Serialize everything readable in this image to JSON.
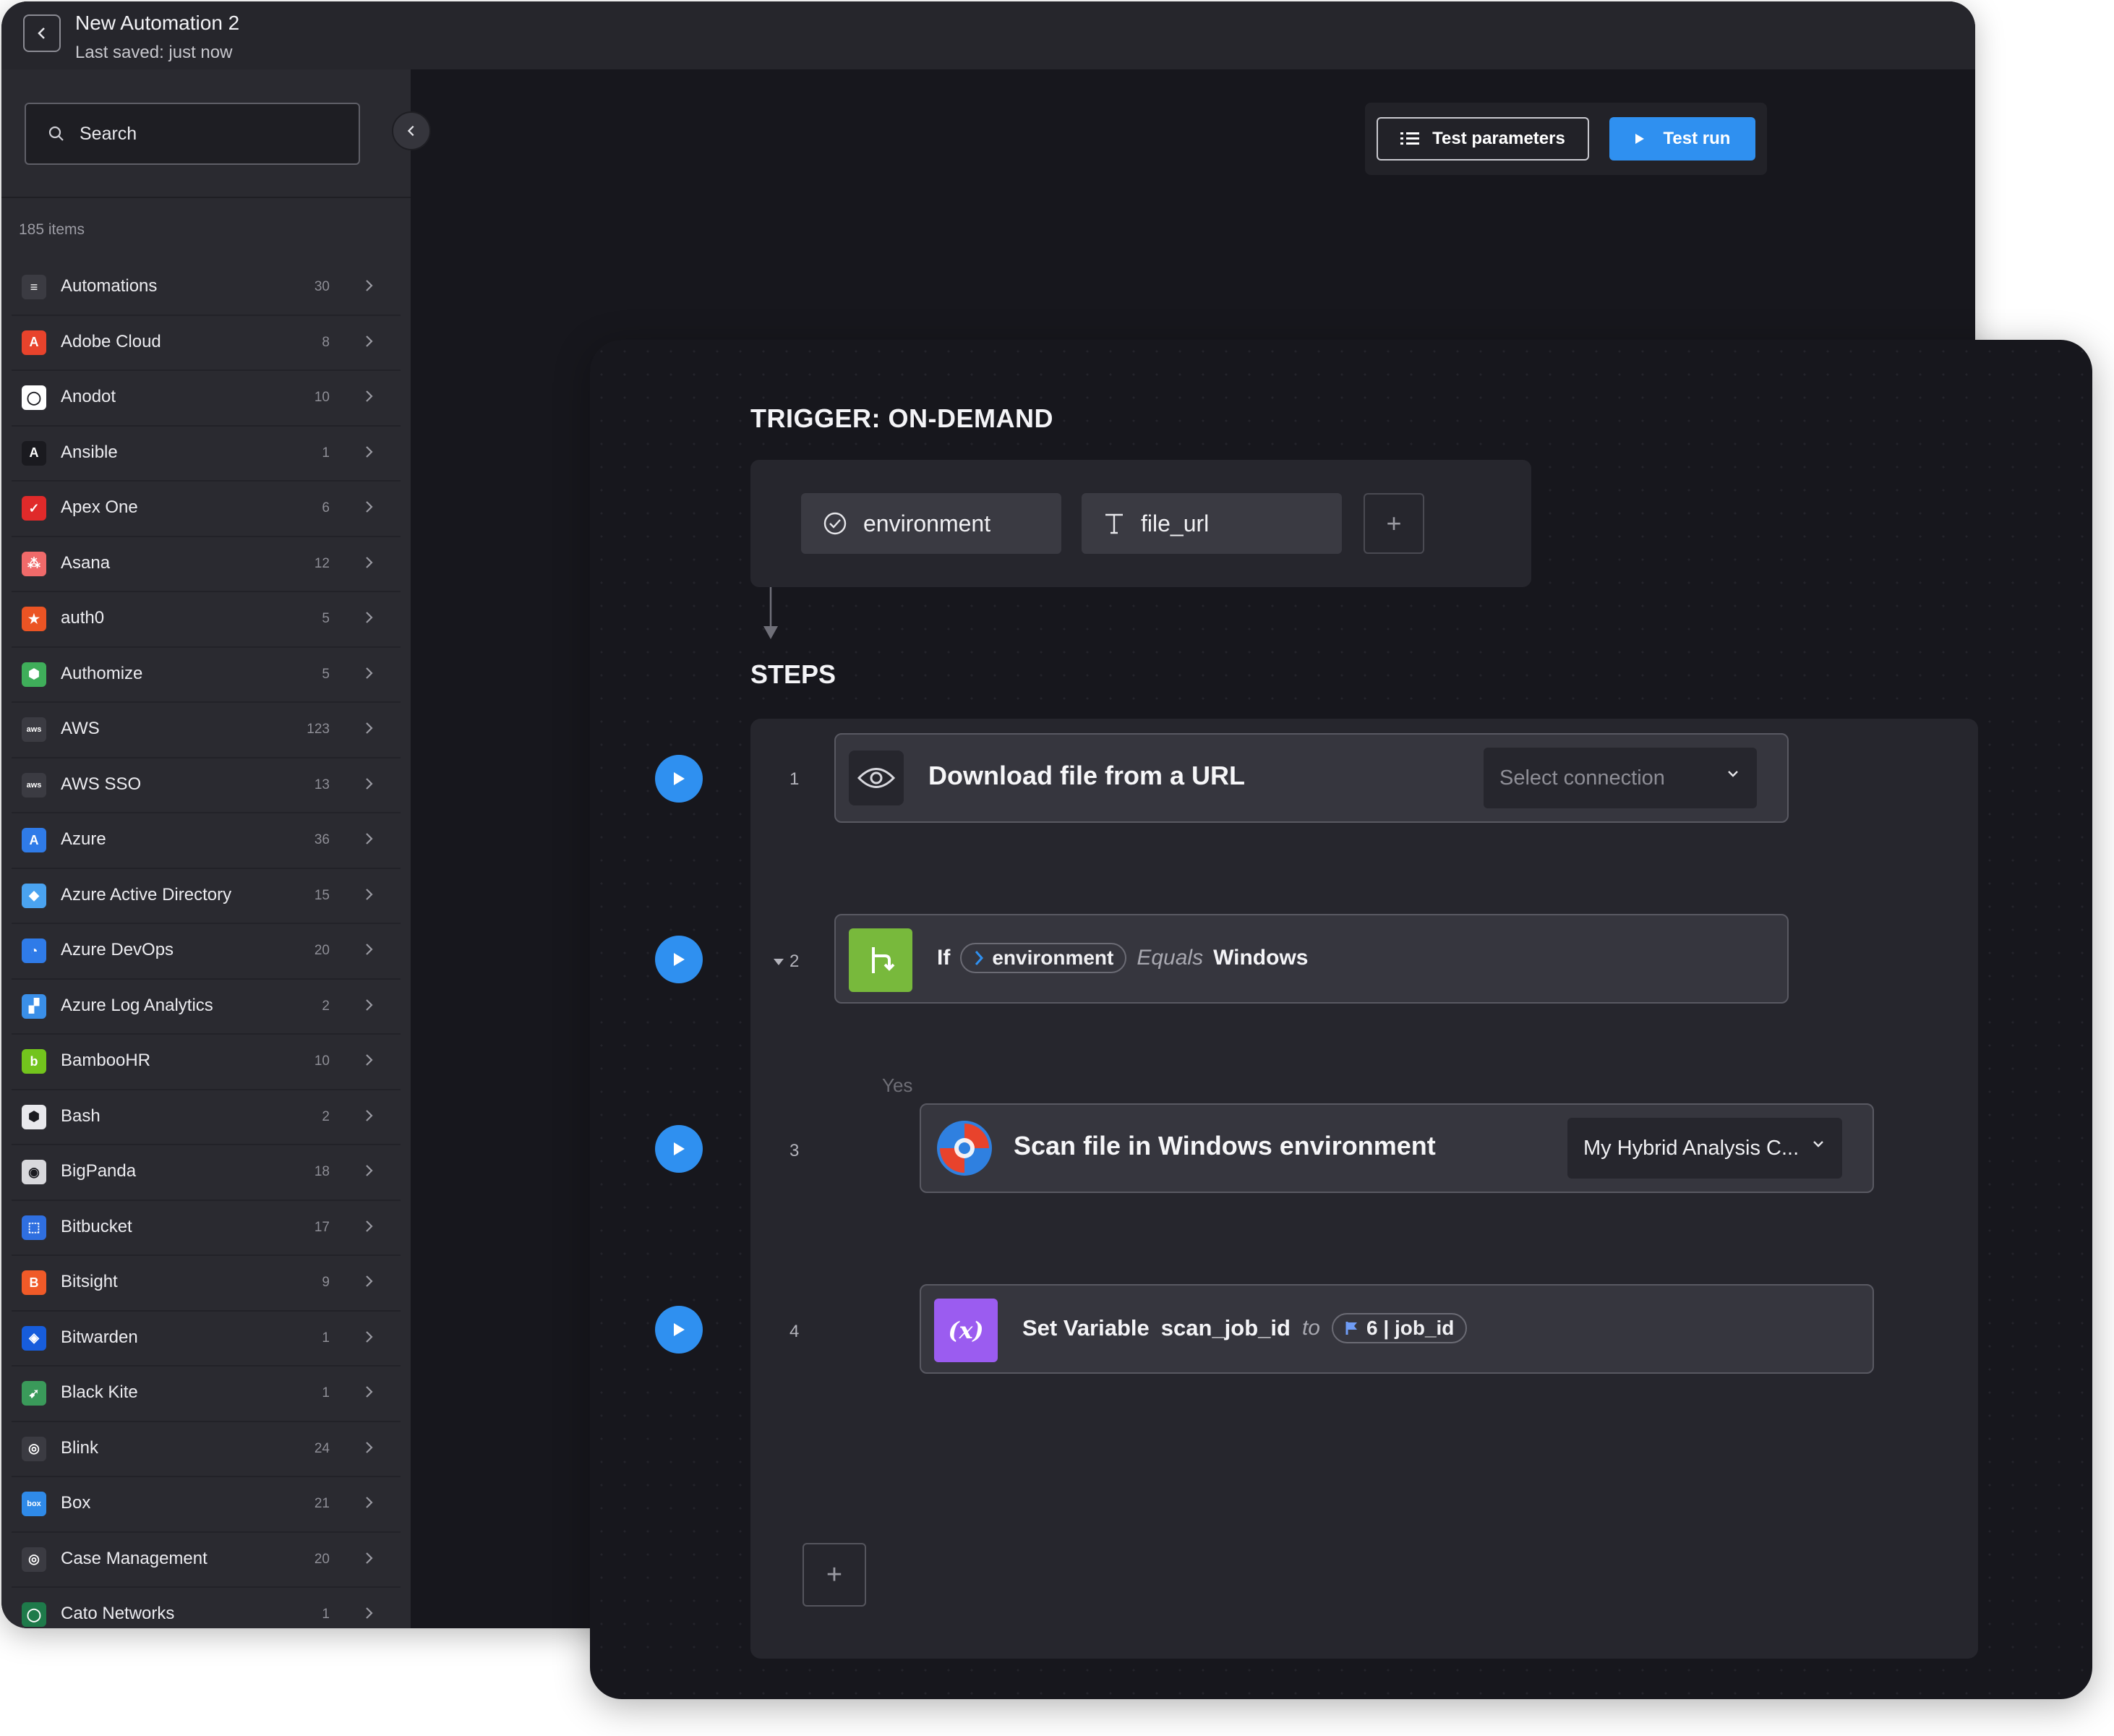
{
  "window": {
    "title": "New Automation 2",
    "subtitle": "Last saved: just now"
  },
  "sidebar": {
    "search_placeholder": "Search",
    "count_label": "185 items",
    "items": [
      {
        "label": "Automations",
        "count": "30",
        "icon": "automations-icon",
        "color": "#3b3b42"
      },
      {
        "label": "Adobe Cloud",
        "count": "8",
        "icon": "adobe-icon",
        "color": "#e8432c"
      },
      {
        "label": "Anodot",
        "count": "10",
        "icon": "anodot-icon",
        "color": "#ffffff"
      },
      {
        "label": "Ansible",
        "count": "1",
        "icon": "ansible-icon",
        "color": "#1a1a1f"
      },
      {
        "label": "Apex One",
        "count": "6",
        "icon": "apex-one-icon",
        "color": "#e02a2a"
      },
      {
        "label": "Asana",
        "count": "12",
        "icon": "asana-icon",
        "color": "#f06a6a"
      },
      {
        "label": "auth0",
        "count": "5",
        "icon": "auth0-icon",
        "color": "#eb5424"
      },
      {
        "label": "Authomize",
        "count": "5",
        "icon": "authomize-icon",
        "color": "#3fae5a"
      },
      {
        "label": "AWS",
        "count": "123",
        "icon": "aws-icon",
        "color": "#3b3b42"
      },
      {
        "label": "AWS SSO",
        "count": "13",
        "icon": "aws-sso-icon",
        "color": "#3b3b42"
      },
      {
        "label": "Azure",
        "count": "36",
        "icon": "azure-icon",
        "color": "#2f7be8"
      },
      {
        "label": "Azure Active Directory",
        "count": "15",
        "icon": "azure-ad-icon",
        "color": "#4aa3f0"
      },
      {
        "label": "Azure DevOps",
        "count": "20",
        "icon": "azure-devops-icon",
        "color": "#2f7be8"
      },
      {
        "label": "Azure Log Analytics",
        "count": "2",
        "icon": "azure-log-analytics-icon",
        "color": "#3a8fe8"
      },
      {
        "label": "BambooHR",
        "count": "10",
        "icon": "bamboohr-icon",
        "color": "#73c41d"
      },
      {
        "label": "Bash",
        "count": "2",
        "icon": "bash-icon",
        "color": "#e8e8ec"
      },
      {
        "label": "BigPanda",
        "count": "18",
        "icon": "bigpanda-icon",
        "color": "#d8d8dc"
      },
      {
        "label": "Bitbucket",
        "count": "17",
        "icon": "bitbucket-icon",
        "color": "#2f6fe0"
      },
      {
        "label": "Bitsight",
        "count": "9",
        "icon": "bitsight-icon",
        "color": "#f05a28"
      },
      {
        "label": "Bitwarden",
        "count": "1",
        "icon": "bitwarden-icon",
        "color": "#175ddc"
      },
      {
        "label": "Black Kite",
        "count": "1",
        "icon": "black-kite-icon",
        "color": "#3a9a5a"
      },
      {
        "label": "Blink",
        "count": "24",
        "icon": "blink-icon",
        "color": "#3b3b42"
      },
      {
        "label": "Box",
        "count": "21",
        "icon": "box-icon",
        "color": "#2f8ae8"
      },
      {
        "label": "Case Management",
        "count": "20",
        "icon": "case-management-icon",
        "color": "#3b3b42"
      },
      {
        "label": "Cato Networks",
        "count": "1",
        "icon": "cato-networks-icon",
        "color": "#1e7a4a"
      }
    ]
  },
  "toolbar": {
    "test_parameters": "Test parameters",
    "test_run": "Test run",
    "accent": "#2f90f0"
  },
  "trigger": {
    "heading": "TRIGGER: ON-DEMAND",
    "params": [
      {
        "name": "environment",
        "icon": "check-circle-icon"
      },
      {
        "name": "file_url",
        "icon": "text-type-icon"
      }
    ],
    "add_label": "+"
  },
  "steps": {
    "heading": "STEPS",
    "add_label": "+",
    "branch_label": "Yes",
    "items": [
      {
        "num": "1",
        "title": "Download file from a URL",
        "select": "Select connection"
      },
      {
        "num": "2",
        "if_word": "If",
        "variable": "environment",
        "operator": "Equals",
        "value": "Windows"
      },
      {
        "num": "3",
        "title": "Scan file in Windows environment",
        "select": "My Hybrid Analysis C..."
      },
      {
        "num": "4",
        "title": "Set Variable",
        "var_name": "scan_job_id",
        "to_word": "to",
        "source": "6 | job_id",
        "icon_text": "(x)"
      }
    ]
  }
}
